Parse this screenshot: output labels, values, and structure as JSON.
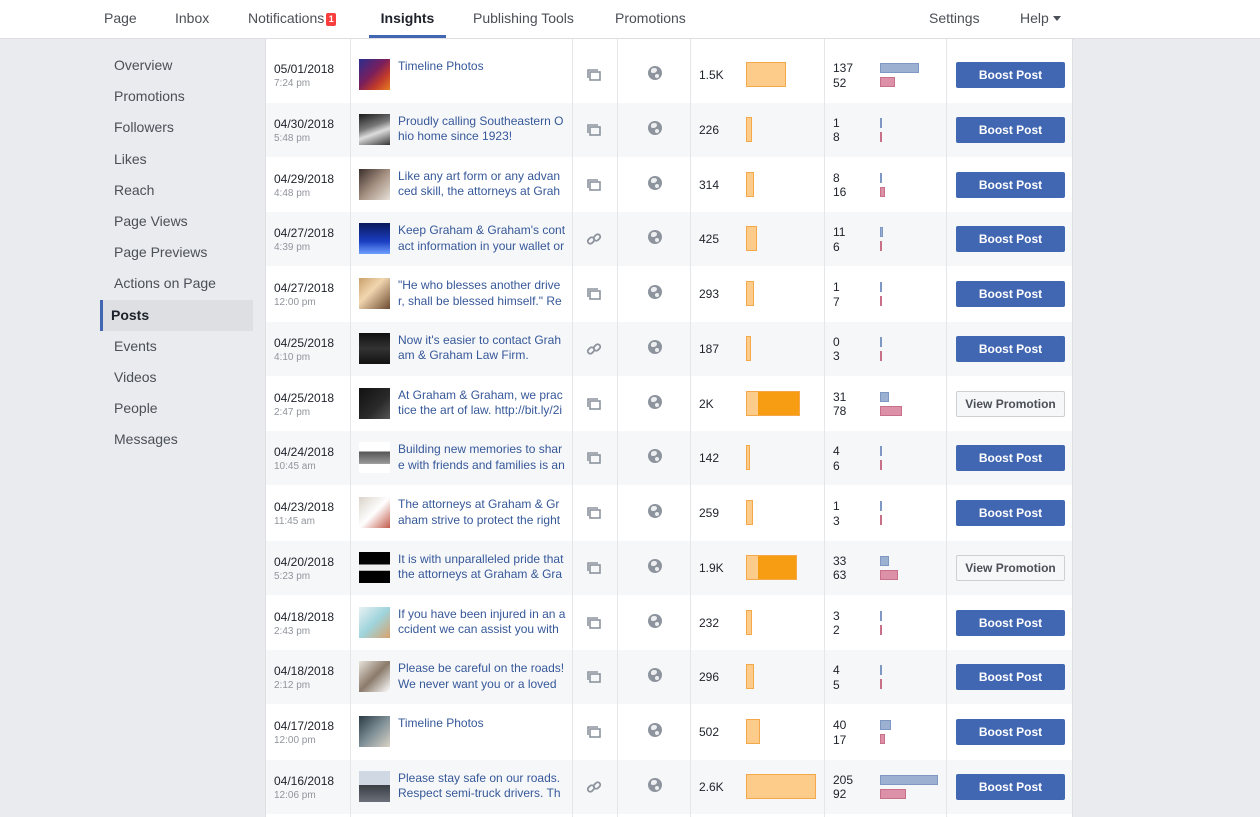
{
  "nav": {
    "page": "Page",
    "inbox": "Inbox",
    "notifications": "Notifications",
    "notifications_count": "1",
    "insights": "Insights",
    "publishing_tools": "Publishing Tools",
    "promotions": "Promotions",
    "settings": "Settings",
    "help": "Help"
  },
  "sidebar": {
    "items": [
      {
        "label": "Overview"
      },
      {
        "label": "Promotions"
      },
      {
        "label": "Followers"
      },
      {
        "label": "Likes"
      },
      {
        "label": "Reach"
      },
      {
        "label": "Page Views"
      },
      {
        "label": "Page Previews"
      },
      {
        "label": "Actions on Page"
      },
      {
        "label": "Posts",
        "active": true
      },
      {
        "label": "Events"
      },
      {
        "label": "Videos"
      },
      {
        "label": "People"
      },
      {
        "label": "Messages"
      }
    ]
  },
  "colors": {
    "accent": "#4267b2",
    "link": "#365899",
    "reach_organic": "#fdcb8a",
    "reach_paid": "#f79d13",
    "engagement_clicks": "#9cb0d2",
    "engagement_reactions": "#dc91a8"
  },
  "posts": [
    {
      "date": "05/01/2018",
      "time": "7:24 pm",
      "text": "Timeline Photos",
      "type": "photo-icon",
      "reach": "1.5K",
      "reach_value": 1500,
      "paid_fraction": 0,
      "eng1": "137",
      "eng2": "52",
      "button": "Boost Post"
    },
    {
      "date": "04/30/2018",
      "time": "5:48 pm",
      "text": "Proudly calling Southeastern Ohio home since 1923!",
      "type": "photo-icon",
      "reach": "226",
      "reach_value": 226,
      "paid_fraction": 0,
      "eng1": "1",
      "eng2": "8",
      "button": "Boost Post"
    },
    {
      "date": "04/29/2018",
      "time": "4:48 pm",
      "text": "Like any art form or any advanced skill, the attorneys at Graha",
      "type": "photo-icon",
      "reach": "314",
      "reach_value": 314,
      "paid_fraction": 0,
      "eng1": "8",
      "eng2": "16",
      "button": "Boost Post"
    },
    {
      "date": "04/27/2018",
      "time": "4:39 pm",
      "text": "Keep Graham & Graham's contact information in your wallet or",
      "type": "link-icon",
      "reach": "425",
      "reach_value": 425,
      "paid_fraction": 0,
      "eng1": "11",
      "eng2": "6",
      "button": "Boost Post"
    },
    {
      "date": "04/27/2018",
      "time": "12:00 pm",
      "text": "\"He who blesses another driver, shall be blessed himself.\" Rem",
      "type": "photo-icon",
      "reach": "293",
      "reach_value": 293,
      "paid_fraction": 0,
      "eng1": "1",
      "eng2": "7",
      "button": "Boost Post"
    },
    {
      "date": "04/25/2018",
      "time": "4:10 pm",
      "text": "Now it's easier to contact Graham & Graham Law Firm.",
      "type": "link-icon",
      "reach": "187",
      "reach_value": 187,
      "paid_fraction": 0,
      "eng1": "0",
      "eng2": "3",
      "button": "Boost Post"
    },
    {
      "date": "04/25/2018",
      "time": "2:47 pm",
      "text": "At Graham & Graham, we practice the art of law. http://bit.ly/2i",
      "type": "photo-icon",
      "reach": "2K",
      "reach_value": 2000,
      "paid_fraction": 0.75,
      "eng1": "31",
      "eng2": "78",
      "button": "View Promotion"
    },
    {
      "date": "04/24/2018",
      "time": "10:45 am",
      "text": "Building new memories to share with friends and families is an",
      "type": "photo-icon",
      "reach": "142",
      "reach_value": 142,
      "paid_fraction": 0,
      "eng1": "4",
      "eng2": "6",
      "button": "Boost Post"
    },
    {
      "date": "04/23/2018",
      "time": "11:45 am",
      "text": "The attorneys at Graham & Graham strive to protect the rights",
      "type": "photo-icon",
      "reach": "259",
      "reach_value": 259,
      "paid_fraction": 0,
      "eng1": "1",
      "eng2": "3",
      "button": "Boost Post"
    },
    {
      "date": "04/20/2018",
      "time": "5:23 pm",
      "text": "It is with unparalleled pride that the attorneys at Graham & Gra",
      "type": "photo-icon",
      "reach": "1.9K",
      "reach_value": 1900,
      "paid_fraction": 0.75,
      "eng1": "33",
      "eng2": "63",
      "button": "View Promotion"
    },
    {
      "date": "04/18/2018",
      "time": "2:43 pm",
      "text": "If you have been injured in an accident we can assist you with",
      "type": "photo-icon",
      "reach": "232",
      "reach_value": 232,
      "paid_fraction": 0,
      "eng1": "3",
      "eng2": "2",
      "button": "Boost Post"
    },
    {
      "date": "04/18/2018",
      "time": "2:12 pm",
      "text": "Please be careful on the roads! We never want you or a loved o",
      "type": "photo-icon",
      "reach": "296",
      "reach_value": 296,
      "paid_fraction": 0,
      "eng1": "4",
      "eng2": "5",
      "button": "Boost Post"
    },
    {
      "date": "04/17/2018",
      "time": "12:00 pm",
      "text": "Timeline Photos",
      "type": "photo-icon",
      "reach": "502",
      "reach_value": 502,
      "paid_fraction": 0,
      "eng1": "40",
      "eng2": "17",
      "button": "Boost Post"
    },
    {
      "date": "04/16/2018",
      "time": "12:06 pm",
      "text": "Please stay safe on our roads. Respect semi-truck drivers. The",
      "type": "link-icon",
      "reach": "2.6K",
      "reach_value": 2600,
      "paid_fraction": 0,
      "eng1": "205",
      "eng2": "92",
      "button": "Boost Post"
    }
  ]
}
